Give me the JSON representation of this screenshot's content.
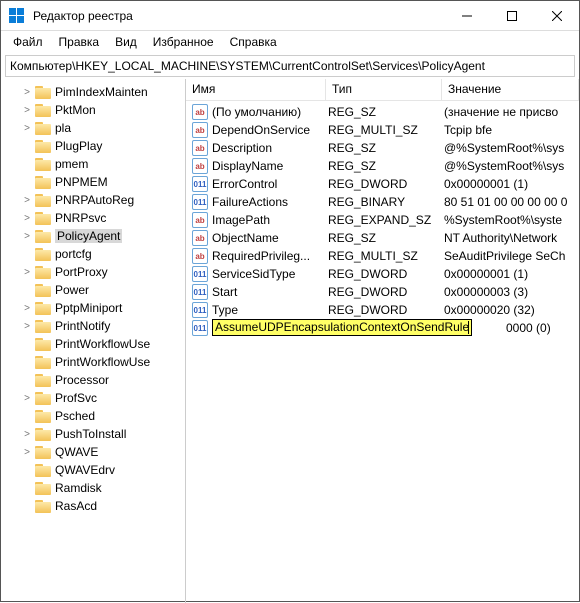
{
  "window": {
    "title": "Редактор реестра"
  },
  "menu": [
    "Файл",
    "Правка",
    "Вид",
    "Избранное",
    "Справка"
  ],
  "addressbar": "Компьютер\\HKEY_LOCAL_MACHINE\\SYSTEM\\CurrentControlSet\\Services\\PolicyAgent",
  "tree": [
    {
      "label": "PimIndexMainten",
      "expandable": true
    },
    {
      "label": "PktMon",
      "expandable": true
    },
    {
      "label": "pla",
      "expandable": true
    },
    {
      "label": "PlugPlay",
      "expandable": false
    },
    {
      "label": "pmem",
      "expandable": false
    },
    {
      "label": "PNPMEM",
      "expandable": false
    },
    {
      "label": "PNRPAutoReg",
      "expandable": true
    },
    {
      "label": "PNRPsvc",
      "expandable": true
    },
    {
      "label": "PolicyAgent",
      "expandable": true,
      "selected": true
    },
    {
      "label": "portcfg",
      "expandable": false
    },
    {
      "label": "PortProxy",
      "expandable": true
    },
    {
      "label": "Power",
      "expandable": false
    },
    {
      "label": "PptpMiniport",
      "expandable": true
    },
    {
      "label": "PrintNotify",
      "expandable": true
    },
    {
      "label": "PrintWorkflowUse",
      "expandable": false
    },
    {
      "label": "PrintWorkflowUse",
      "expandable": false
    },
    {
      "label": "Processor",
      "expandable": false
    },
    {
      "label": "ProfSvc",
      "expandable": true
    },
    {
      "label": "Psched",
      "expandable": false
    },
    {
      "label": "PushToInstall",
      "expandable": true
    },
    {
      "label": "QWAVE",
      "expandable": true
    },
    {
      "label": "QWAVEdrv",
      "expandable": false
    },
    {
      "label": "Ramdisk",
      "expandable": false
    },
    {
      "label": "RasAcd",
      "expandable": false
    }
  ],
  "columns": {
    "name": "Имя",
    "type": "Тип",
    "value": "Значение"
  },
  "values": [
    {
      "icon": "str",
      "name": "(По умолчанию)",
      "type": "REG_SZ",
      "value": "(значение не присво"
    },
    {
      "icon": "str",
      "name": "DependOnService",
      "type": "REG_MULTI_SZ",
      "value": "Tcpip bfe"
    },
    {
      "icon": "str",
      "name": "Description",
      "type": "REG_SZ",
      "value": "@%SystemRoot%\\sys"
    },
    {
      "icon": "str",
      "name": "DisplayName",
      "type": "REG_SZ",
      "value": "@%SystemRoot%\\sys"
    },
    {
      "icon": "bin",
      "name": "ErrorControl",
      "type": "REG_DWORD",
      "value": "0x00000001 (1)"
    },
    {
      "icon": "bin",
      "name": "FailureActions",
      "type": "REG_BINARY",
      "value": "80 51 01 00 00 00 00 0"
    },
    {
      "icon": "str",
      "name": "ImagePath",
      "type": "REG_EXPAND_SZ",
      "value": "%SystemRoot%\\syste"
    },
    {
      "icon": "str",
      "name": "ObjectName",
      "type": "REG_SZ",
      "value": "NT Authority\\Network"
    },
    {
      "icon": "str",
      "name": "RequiredPrivileg...",
      "type": "REG_MULTI_SZ",
      "value": "SeAuditPrivilege SeCh"
    },
    {
      "icon": "bin",
      "name": "ServiceSidType",
      "type": "REG_DWORD",
      "value": "0x00000001 (1)"
    },
    {
      "icon": "bin",
      "name": "Start",
      "type": "REG_DWORD",
      "value": "0x00000003 (3)"
    },
    {
      "icon": "bin",
      "name": "Type",
      "type": "REG_DWORD",
      "value": "0x00000020 (32)"
    }
  ],
  "editing": {
    "icon": "bin",
    "name": "AssumeUDPEncapsulationContextOnSendRule",
    "trailing": "0000 (0)"
  },
  "icon_glyph": {
    "str": "ab",
    "bin": "011"
  }
}
